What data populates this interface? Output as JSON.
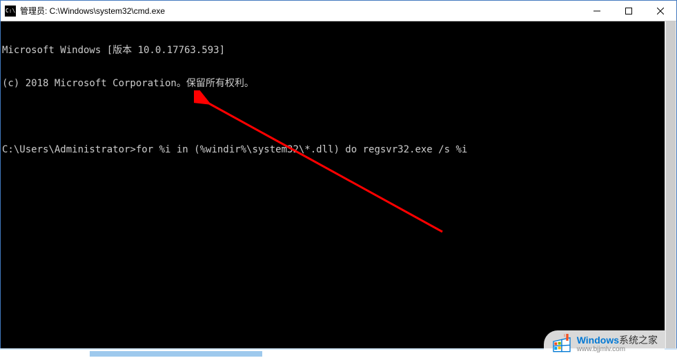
{
  "titlebar": {
    "icon_label": "C:\\",
    "title": "管理员: C:\\Windows\\system32\\cmd.exe"
  },
  "terminal": {
    "line1": "Microsoft Windows [版本 10.0.17763.593]",
    "line2": "(c) 2018 Microsoft Corporation。保留所有权利。",
    "blank": "",
    "prompt": "C:\\Users\\Administrator>",
    "command": "for %i in (%windir%\\system32\\*.dll) do regsvr32.exe /s %i"
  },
  "watermark": {
    "brand_bold": "Windows",
    "brand_rest": "系统之家",
    "url": "www.bjjmlv.com"
  }
}
